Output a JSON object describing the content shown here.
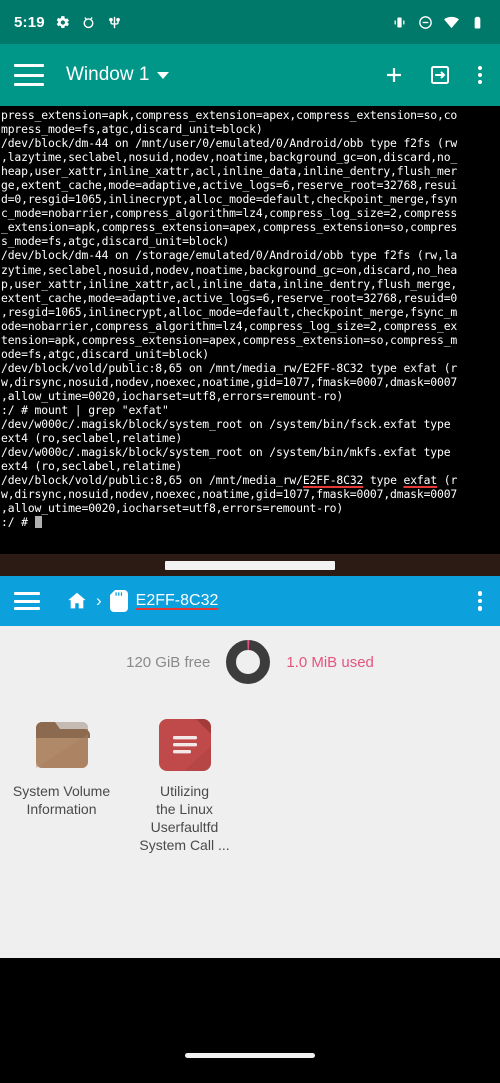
{
  "status_bar": {
    "time": "5:19",
    "left_icons": [
      "gear-icon",
      "bug-icon",
      "usb-icon"
    ],
    "right_icons": [
      "vibrate-icon",
      "do-not-disturb-icon",
      "wifi-icon",
      "battery-icon"
    ],
    "background_color": "#00796B"
  },
  "terminal_app": {
    "toolbar": {
      "menu_label": "menu-icon",
      "title": "Window 1",
      "dropdown_icon": "chevron-down-icon",
      "new_session_label": "add-icon",
      "keyboard_icon": "input-arrow-icon",
      "overflow_label": "more-options-icon",
      "background_color": "#009688"
    },
    "lines": [
      [
        {
          "t": "press_extension=apk,compress_extension=apex,compress_extension=so,co"
        }
      ],
      [
        {
          "t": "mpress_mode=fs,atgc,discard_unit=block)"
        }
      ],
      [
        {
          "t": "/dev/block/dm-44 on /mnt/user/0/emulated/0/Android/obb type f2fs (rw"
        }
      ],
      [
        {
          "t": ",lazytime,seclabel,nosuid,nodev,noatime,background_gc=on,discard,no_"
        }
      ],
      [
        {
          "t": "heap,user_xattr,inline_xattr,acl,inline_data,inline_dentry,flush_mer"
        }
      ],
      [
        {
          "t": "ge,extent_cache,mode=adaptive,active_logs=6,reserve_root=32768,resui"
        }
      ],
      [
        {
          "t": "d=0,resgid=1065,inlinecrypt,alloc_mode=default,checkpoint_merge,fsyn"
        }
      ],
      [
        {
          "t": "c_mode=nobarrier,compress_algorithm=lz4,compress_log_size=2,compress"
        }
      ],
      [
        {
          "t": "_extension=apk,compress_extension=apex,compress_extension=so,compres"
        }
      ],
      [
        {
          "t": "s_mode=fs,atgc,discard_unit=block)"
        }
      ],
      [
        {
          "t": "/dev/block/dm-44 on /storage/emulated/0/Android/obb type f2fs (rw,la"
        }
      ],
      [
        {
          "t": "zytime,seclabel,nosuid,nodev,noatime,background_gc=on,discard,no_hea"
        }
      ],
      [
        {
          "t": "p,user_xattr,inline_xattr,acl,inline_data,inline_dentry,flush_merge,"
        }
      ],
      [
        {
          "t": "extent_cache,mode=adaptive,active_logs=6,reserve_root=32768,resuid=0"
        }
      ],
      [
        {
          "t": ",resgid=1065,inlinecrypt,alloc_mode=default,checkpoint_merge,fsync_m"
        }
      ],
      [
        {
          "t": "ode=nobarrier,compress_algorithm=lz4,compress_log_size=2,compress_ex"
        }
      ],
      [
        {
          "t": "tension=apk,compress_extension=apex,compress_extension=so,compress_m"
        }
      ],
      [
        {
          "t": "ode=fs,atgc,discard_unit=block)"
        }
      ],
      [
        {
          "t": "/dev/block/vold/public:8,65 on /mnt/media_rw/E2FF-8C32 type exfat (r"
        }
      ],
      [
        {
          "t": "w,dirsync,nosuid,nodev,noexec,noatime,gid=1077,fmask=0007,dmask=0007"
        }
      ],
      [
        {
          "t": ",allow_utime=0020,iocharset=utf8,errors=remount-ro)"
        }
      ],
      [
        {
          "t": ":/ # mount | grep \"exfat\""
        }
      ],
      [
        {
          "t": "/dev/w000c/.magisk/block/system_root on /system/bin/fsck.exfat type"
        }
      ],
      [
        {
          "t": "ext4 (ro,seclabel,relatime)"
        }
      ],
      [
        {
          "t": "/dev/w000c/.magisk/block/system_root on /system/bin/mkfs.exfat type"
        }
      ],
      [
        {
          "t": "ext4 (ro,seclabel,relatime)"
        }
      ],
      [
        {
          "t": "/dev/block/vold/public:8,65 on /mnt/media_rw/"
        },
        {
          "t": "E2FF-8C32",
          "u": true
        },
        {
          "t": " type "
        },
        {
          "t": "exfat",
          "u": true
        },
        {
          "t": " (r"
        }
      ],
      [
        {
          "t": "w,dirsync,nosuid,nodev,noexec,noatime,gid=1077,fmask=0007,dmask=0007"
        }
      ],
      [
        {
          "t": ",allow_utime=0020,iocharset=utf8,errors=remount-ro)"
        }
      ],
      [
        {
          "t": ":/ # ",
          "cursor": true
        }
      ]
    ],
    "scrollbar": "horizontal-scrollbar"
  },
  "file_manager": {
    "toolbar": {
      "menu_label": "menu-icon",
      "home_label": "home-icon",
      "separator": "›",
      "volume_icon": "sd-card-icon",
      "current_path": "E2FF-8C32",
      "overflow_label": "more-options-icon",
      "background_color": "#0CA0DC"
    },
    "storage": {
      "free_text": "120 GiB free",
      "used_text": "1.0 MiB used",
      "free_color": "#8a8a8a",
      "used_color": "#E3557F",
      "ring_color": "#3c3c3c",
      "used_percent": 1
    },
    "items": [
      {
        "name": "System Volume Information",
        "type": "folder",
        "icon": "folder-icon",
        "icon_color": "#B08968"
      },
      {
        "name": "Utilizing the Linux Userfaultfd System Call ...",
        "display_name": "Utilizing\nthe Linux\nUserfaultfd\nSystem Call ...",
        "type": "document",
        "icon": "document-icon",
        "icon_color": "#C04A4A"
      }
    ]
  },
  "nav_bar": {
    "gesture_pill": "home-gesture-pill"
  }
}
